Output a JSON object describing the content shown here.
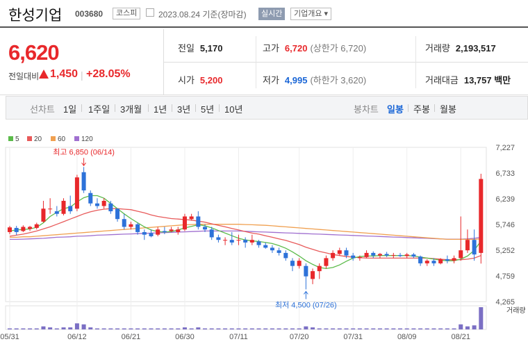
{
  "header": {
    "name": "한성기업",
    "code": "003680",
    "market": "코스피",
    "date": "2023.08.24 기준(장마감)",
    "realtime_btn": "실시간",
    "company_info_btn": "기업개요 ▾"
  },
  "summary": {
    "price": "6,620",
    "vs_label": "전일대비",
    "vs_amount": "1,450",
    "vs_percent": "+28.05%",
    "prev_close_label": "전일",
    "prev_close": "5,170",
    "high_label": "고가",
    "high": "6,720",
    "upper_limit": "(상한가 6,720)",
    "volume_label": "거래량",
    "volume": "2,193,517",
    "open_label": "시가",
    "open": "5,200",
    "low_label": "저가",
    "low": "4,995",
    "lower_limit": "(하한가 3,620)",
    "amount_label": "거래대금",
    "amount": "13,757 백만"
  },
  "tabs": {
    "line_label": "선차트",
    "line_items": [
      "1일",
      "1주일",
      "3개월",
      "1년",
      "3년",
      "5년",
      "10년"
    ],
    "candle_label": "봉차트",
    "candle_items": [
      "일봉",
      "주봉",
      "월봉"
    ],
    "selected": "일봉"
  },
  "chart_data": {
    "type": "candlestick",
    "legend": [
      "5",
      "20",
      "60",
      "120"
    ],
    "colors": {
      "ma5": "#5bbb4a",
      "ma20": "#e85a5a",
      "ma60": "#f0a050",
      "ma120": "#a070d0",
      "up": "#e8282b",
      "down": "#2d72d9",
      "volume": "#7b6fc4"
    },
    "y_ticks": [
      "7,227",
      "6,733",
      "6,239",
      "5,746",
      "5,252",
      "4,759",
      "4,265"
    ],
    "ylim": [
      4265,
      7227
    ],
    "x_ticks": [
      "05/31",
      "06/12",
      "06/21",
      "06/30",
      "07/11",
      "07/20",
      "07/31",
      "08/09",
      "08/21"
    ],
    "high_annotation": "최고 6,850 (06/14)",
    "low_annotation": "최저 4,500 (07/26)",
    "volume_label": "거래량",
    "candles": [
      {
        "o": 5600,
        "h": 5720,
        "l": 5560,
        "c": 5690
      },
      {
        "o": 5680,
        "h": 5720,
        "l": 5540,
        "c": 5600
      },
      {
        "o": 5620,
        "h": 5730,
        "l": 5600,
        "c": 5700
      },
      {
        "o": 5660,
        "h": 5720,
        "l": 5620,
        "c": 5700
      },
      {
        "o": 5680,
        "h": 5780,
        "l": 5650,
        "c": 5750
      },
      {
        "o": 5800,
        "h": 6200,
        "l": 5780,
        "c": 6050
      },
      {
        "o": 6050,
        "h": 6250,
        "l": 5950,
        "c": 6050
      },
      {
        "o": 6000,
        "h": 6100,
        "l": 5900,
        "c": 5950
      },
      {
        "o": 5950,
        "h": 6250,
        "l": 5920,
        "c": 6200
      },
      {
        "o": 6100,
        "h": 6300,
        "l": 5950,
        "c": 6000
      },
      {
        "o": 6050,
        "h": 6700,
        "l": 6000,
        "c": 6650
      },
      {
        "o": 6750,
        "h": 6850,
        "l": 6350,
        "c": 6400
      },
      {
        "o": 6350,
        "h": 6400,
        "l": 6100,
        "c": 6150
      },
      {
        "o": 6150,
        "h": 6250,
        "l": 6050,
        "c": 6100
      },
      {
        "o": 6100,
        "h": 6250,
        "l": 6050,
        "c": 6200
      },
      {
        "o": 6150,
        "h": 6200,
        "l": 5950,
        "c": 6000
      },
      {
        "o": 6050,
        "h": 6050,
        "l": 5800,
        "c": 5850
      },
      {
        "o": 5850,
        "h": 5950,
        "l": 5650,
        "c": 5700
      },
      {
        "o": 5700,
        "h": 5800,
        "l": 5650,
        "c": 5750
      },
      {
        "o": 5750,
        "h": 5780,
        "l": 5550,
        "c": 5600
      },
      {
        "o": 5600,
        "h": 5650,
        "l": 5450,
        "c": 5550
      },
      {
        "o": 5580,
        "h": 5650,
        "l": 5500,
        "c": 5520
      },
      {
        "o": 5550,
        "h": 5700,
        "l": 5520,
        "c": 5650
      },
      {
        "o": 5620,
        "h": 5700,
        "l": 5560,
        "c": 5600
      },
      {
        "o": 5620,
        "h": 5700,
        "l": 5600,
        "c": 5650
      },
      {
        "o": 5600,
        "h": 5700,
        "l": 5550,
        "c": 5650
      },
      {
        "o": 5650,
        "h": 5950,
        "l": 5620,
        "c": 5900
      },
      {
        "o": 5850,
        "h": 5950,
        "l": 5820,
        "c": 5900
      },
      {
        "o": 5900,
        "h": 6000,
        "l": 5650,
        "c": 5700
      },
      {
        "o": 5700,
        "h": 5750,
        "l": 5600,
        "c": 5650
      },
      {
        "o": 5650,
        "h": 5700,
        "l": 5450,
        "c": 5500
      },
      {
        "o": 5500,
        "h": 5550,
        "l": 5400,
        "c": 5450
      },
      {
        "o": 5450,
        "h": 5500,
        "l": 5350,
        "c": 5450
      },
      {
        "o": 5450,
        "h": 5600,
        "l": 5350,
        "c": 5400
      },
      {
        "o": 5450,
        "h": 5550,
        "l": 5350,
        "c": 5450
      },
      {
        "o": 5450,
        "h": 5500,
        "l": 5300,
        "c": 5400
      },
      {
        "o": 5400,
        "h": 5550,
        "l": 5350,
        "c": 5450
      },
      {
        "o": 5420,
        "h": 5450,
        "l": 5300,
        "c": 5350
      },
      {
        "o": 5350,
        "h": 5400,
        "l": 5280,
        "c": 5300
      },
      {
        "o": 5300,
        "h": 5350,
        "l": 5200,
        "c": 5250
      },
      {
        "o": 5250,
        "h": 5300,
        "l": 5150,
        "c": 5200
      },
      {
        "o": 5200,
        "h": 5250,
        "l": 5050,
        "c": 5100
      },
      {
        "o": 5050,
        "h": 5100,
        "l": 4850,
        "c": 4950
      },
      {
        "o": 4950,
        "h": 5100,
        "l": 4900,
        "c": 5050
      },
      {
        "o": 4950,
        "h": 5000,
        "l": 4500,
        "c": 4750
      },
      {
        "o": 4700,
        "h": 4900,
        "l": 4600,
        "c": 4850
      },
      {
        "o": 4850,
        "h": 5000,
        "l": 4700,
        "c": 4950
      },
      {
        "o": 4950,
        "h": 5150,
        "l": 4900,
        "c": 5100
      },
      {
        "o": 5100,
        "h": 5250,
        "l": 5050,
        "c": 5200
      },
      {
        "o": 5180,
        "h": 5300,
        "l": 5150,
        "c": 5250
      },
      {
        "o": 5250,
        "h": 5300,
        "l": 5100,
        "c": 5150
      },
      {
        "o": 5150,
        "h": 5200,
        "l": 5050,
        "c": 5100
      },
      {
        "o": 5100,
        "h": 5150,
        "l": 5050,
        "c": 5120
      },
      {
        "o": 5120,
        "h": 5250,
        "l": 5100,
        "c": 5200
      },
      {
        "o": 5200,
        "h": 5230,
        "l": 5100,
        "c": 5150
      },
      {
        "o": 5150,
        "h": 5200,
        "l": 5100,
        "c": 5180
      },
      {
        "o": 5180,
        "h": 5220,
        "l": 5120,
        "c": 5150
      },
      {
        "o": 5150,
        "h": 5200,
        "l": 5100,
        "c": 5160
      },
      {
        "o": 5160,
        "h": 5200,
        "l": 5120,
        "c": 5140
      },
      {
        "o": 5140,
        "h": 5200,
        "l": 5100,
        "c": 5170
      },
      {
        "o": 5170,
        "h": 5200,
        "l": 5100,
        "c": 5130
      },
      {
        "o": 5130,
        "h": 5150,
        "l": 4950,
        "c": 5000
      },
      {
        "o": 5000,
        "h": 5080,
        "l": 4950,
        "c": 5050
      },
      {
        "o": 5050,
        "h": 5100,
        "l": 4950,
        "c": 5000
      },
      {
        "o": 5000,
        "h": 5100,
        "l": 4980,
        "c": 5080
      },
      {
        "o": 5080,
        "h": 5150,
        "l": 5000,
        "c": 5050
      },
      {
        "o": 5050,
        "h": 5150,
        "l": 5000,
        "c": 5100
      },
      {
        "o": 5100,
        "h": 5900,
        "l": 5050,
        "c": 5250
      },
      {
        "o": 5250,
        "h": 5650,
        "l": 5200,
        "c": 5450
      },
      {
        "o": 5450,
        "h": 5650,
        "l": 5050,
        "c": 5170
      },
      {
        "o": 5200,
        "h": 6720,
        "l": 4995,
        "c": 6620
      }
    ],
    "volumes": [
      1,
      1,
      1,
      1,
      1,
      3,
      2,
      1,
      2,
      2,
      6,
      5,
      2,
      1,
      1,
      1,
      1,
      1,
      1,
      1,
      1,
      1,
      1,
      1,
      1,
      1,
      2,
      1,
      2,
      1,
      1,
      1,
      1,
      1,
      1,
      1,
      1,
      1,
      1,
      1,
      1,
      1,
      1,
      1,
      3,
      2,
      1,
      1,
      1,
      1,
      1,
      1,
      1,
      1,
      1,
      1,
      1,
      1,
      1,
      1,
      1,
      1,
      1,
      1,
      1,
      1,
      1,
      5,
      3,
      4,
      22
    ],
    "ma5": [
      5620,
      5640,
      5650,
      5660,
      5690,
      5780,
      5900,
      5980,
      6050,
      6080,
      6180,
      6260,
      6300,
      6300,
      6250,
      6150,
      6050,
      5950,
      5860,
      5780,
      5700,
      5640,
      5610,
      5600,
      5610,
      5640,
      5680,
      5710,
      5740,
      5720,
      5680,
      5630,
      5580,
      5530,
      5480,
      5450,
      5430,
      5420,
      5400,
      5380,
      5340,
      5290,
      5220,
      5140,
      5050,
      4980,
      4920,
      4900,
      4920,
      4970,
      5040,
      5100,
      5130,
      5140,
      5140,
      5150,
      5150,
      5150,
      5150,
      5150,
      5140,
      5120,
      5100,
      5080,
      5060,
      5050,
      5050,
      5080,
      5140,
      5250,
      5430
    ],
    "ma20": [
      5520,
      5540,
      5560,
      5590,
      5620,
      5660,
      5700,
      5750,
      5800,
      5850,
      5900,
      5950,
      5990,
      6020,
      6040,
      6050,
      6050,
      6040,
      6030,
      6000,
      5970,
      5930,
      5900,
      5880,
      5860,
      5850,
      5840,
      5830,
      5810,
      5790,
      5760,
      5730,
      5700,
      5670,
      5640,
      5610,
      5580,
      5560,
      5530,
      5500,
      5470,
      5440,
      5400,
      5360,
      5310,
      5270,
      5230,
      5200,
      5170,
      5150,
      5130,
      5120,
      5110,
      5100,
      5100,
      5100,
      5100,
      5100,
      5100,
      5100,
      5100,
      5100,
      5100,
      5090,
      5080,
      5070,
      5070,
      5070,
      5080,
      5100,
      5150
    ],
    "ma60": [
      5500,
      5500,
      5510,
      5510,
      5520,
      5530,
      5540,
      5550,
      5560,
      5570,
      5580,
      5590,
      5600,
      5610,
      5620,
      5630,
      5640,
      5650,
      5660,
      5670,
      5680,
      5690,
      5700,
      5710,
      5720,
      5730,
      5740,
      5745,
      5750,
      5750,
      5750,
      5750,
      5750,
      5750,
      5750,
      5745,
      5740,
      5735,
      5730,
      5720,
      5710,
      5700,
      5690,
      5680,
      5670,
      5660,
      5650,
      5640,
      5630,
      5620,
      5610,
      5600,
      5590,
      5580,
      5570,
      5560,
      5550,
      5540,
      5530,
      5520,
      5510,
      5500,
      5490,
      5480,
      5470,
      5460,
      5460,
      5460,
      5460,
      5460,
      5470
    ],
    "ma120": [
      5460,
      5460,
      5465,
      5470,
      5475,
      5480,
      5490,
      5500,
      5505,
      5510,
      5520,
      5525,
      5530,
      5540,
      5545,
      5550,
      5555,
      5560,
      5565,
      5570,
      5575,
      5580,
      5585,
      5590,
      5595,
      5600,
      5605,
      5610,
      5615,
      5620,
      5620,
      5620,
      5620,
      5620,
      5620,
      5615,
      5610,
      5605,
      5600,
      5595,
      5590,
      5585,
      5580,
      5575,
      5570,
      5565,
      5560,
      5555,
      5550,
      5545,
      5540,
      5535,
      5530,
      5525,
      5520,
      5515,
      5510,
      5505,
      5500,
      5495,
      5490,
      5485,
      5480,
      5475,
      5470,
      5465,
      5465,
      5465,
      5470,
      5480,
      5500
    ]
  }
}
